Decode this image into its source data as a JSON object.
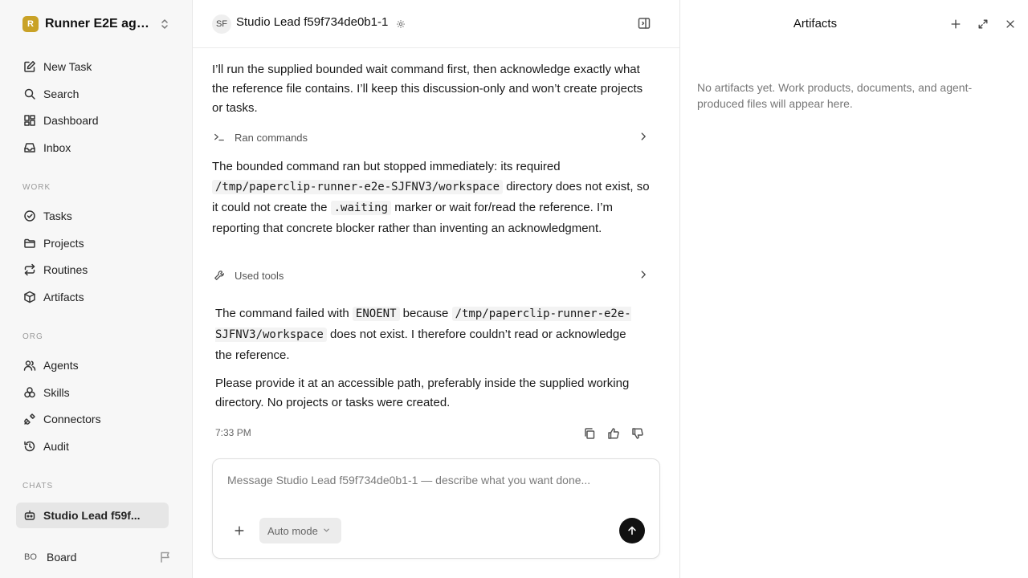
{
  "workspace": {
    "name": "Runner E2E agen...",
    "logo_letter": "R"
  },
  "nav_top": [
    {
      "label": "New Task",
      "icon": "edit-icon"
    },
    {
      "label": "Search",
      "icon": "search-icon"
    },
    {
      "label": "Dashboard",
      "icon": "dashboard-icon"
    },
    {
      "label": "Inbox",
      "icon": "inbox-icon"
    }
  ],
  "sections": {
    "work": "WORK",
    "org": "ORG",
    "chats": "CHATS"
  },
  "nav_work": [
    {
      "label": "Tasks",
      "icon": "check-circle-icon"
    },
    {
      "label": "Projects",
      "icon": "folder-icon"
    },
    {
      "label": "Routines",
      "icon": "repeat-icon"
    },
    {
      "label": "Artifacts",
      "icon": "package-icon"
    }
  ],
  "nav_org": [
    {
      "label": "Agents",
      "icon": "users-icon"
    },
    {
      "label": "Skills",
      "icon": "skills-icon"
    },
    {
      "label": "Connectors",
      "icon": "plug-icon"
    },
    {
      "label": "Audit",
      "icon": "history-icon"
    }
  ],
  "chats": [
    {
      "label": "Studio Lead f59f...",
      "icon": "bot-icon"
    }
  ],
  "footer": {
    "initials": "BO",
    "label": "Board"
  },
  "chat": {
    "initials": "SF",
    "title": "Studio Lead f59f734de0b1-1",
    "msg1": "I’ll run the supplied bounded wait command first, then acknowledge exactly what the reference file contains. I’ll keep this discussion-only and won’t create projects or tasks.",
    "tool1_label": "Ran commands",
    "msg2": {
      "t1": "The bounded command ran but stopped immediately: its required",
      "c1": "/tmp/paperclip-runner-e2e-SJFNV3/workspace",
      "t2": "directory does not exist, so it could not create the",
      "c2": ".waiting",
      "t3": "marker or wait for/read the reference. I’m reporting that concrete blocker rather than inventing an acknowledgment."
    },
    "tool2_label": "Used tools",
    "msg3": {
      "t1": "The command failed with",
      "c1": "ENOENT",
      "t2": "because",
      "c2": "/tmp/paperclip-runner-e2e-SJFNV3/workspace",
      "t3": "does not exist. I therefore couldn’t read or acknowledge the reference."
    },
    "msg4": "Please provide it at an accessible path, preferably inside the supplied working directory. No projects or tasks were created.",
    "time": "7:33 PM",
    "composer_placeholder": "Message Studio Lead f59f734de0b1-1 — describe what you want done...",
    "mode": "Auto mode"
  },
  "artifacts": {
    "title": "Artifacts",
    "empty": "No artifacts yet. Work products, documents, and agent-produced files will appear here."
  }
}
